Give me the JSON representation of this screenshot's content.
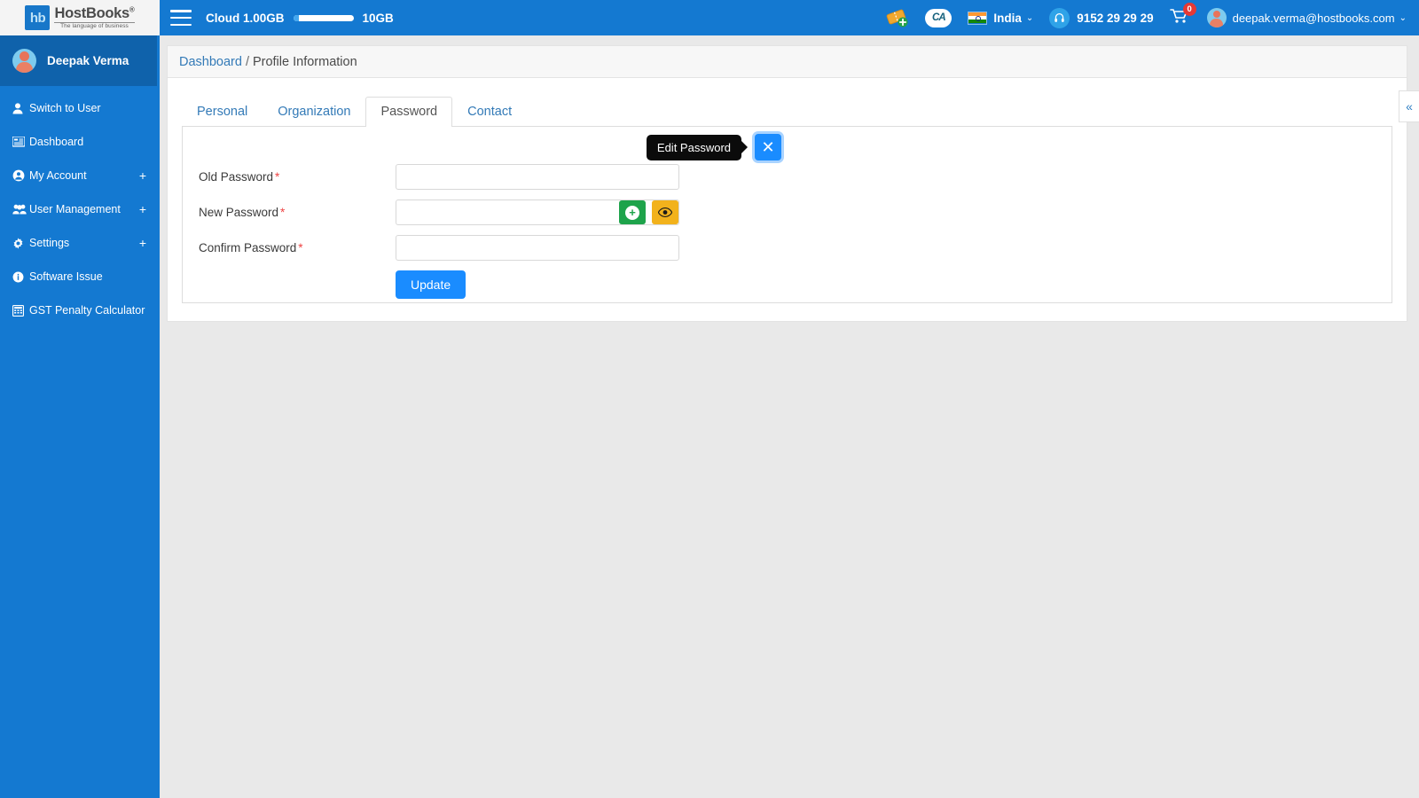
{
  "brand": {
    "tile": "hb",
    "name": "HostBooks",
    "reg": "®",
    "tagline": "The language of business"
  },
  "topbar": {
    "menu_icon": "hamburger-icon",
    "cloud_label": "Cloud 1.00GB",
    "cloud_max": "10GB",
    "cloud_used_percent": 10,
    "ticket_icon": "add-ticket-icon",
    "ca_badge": "CA",
    "country": "India",
    "country_caret": "⌄",
    "support_icon": "headset-icon",
    "phone": "9152 29 29 29",
    "cart_icon": "cart-icon",
    "cart_count": "0",
    "user_email": "deepak.verma@hostbooks.com",
    "user_caret": "⌄"
  },
  "sidebar": {
    "profile_name": "Deepak Verma",
    "items": [
      {
        "label": "Switch to User",
        "icon": "user-icon",
        "glyph": "👤",
        "expand": ""
      },
      {
        "label": "Dashboard",
        "icon": "dashboard-icon",
        "glyph": "☷",
        "expand": ""
      },
      {
        "label": "My Account",
        "icon": "account-circle-icon",
        "glyph": "◉",
        "expand": "+"
      },
      {
        "label": "User Management",
        "icon": "users-group-icon",
        "glyph": "👥",
        "expand": "+"
      },
      {
        "label": "Settings",
        "icon": "gear-icon",
        "glyph": "⚙",
        "expand": "+"
      },
      {
        "label": "Software Issue",
        "icon": "info-circle-icon",
        "glyph": "ℹ",
        "expand": ""
      },
      {
        "label": "GST Penalty Calculator",
        "icon": "calculator-icon",
        "glyph": "▦",
        "expand": ""
      }
    ]
  },
  "breadcrumb": {
    "root": "Dashboard",
    "separator": "/",
    "current": "Profile Information"
  },
  "tabs": [
    {
      "label": "Personal",
      "active": false
    },
    {
      "label": "Organization",
      "active": false
    },
    {
      "label": "Password",
      "active": true
    },
    {
      "label": "Contact",
      "active": false
    }
  ],
  "password_form": {
    "tooltip": "Edit Password",
    "close_icon": "✕",
    "fields": [
      {
        "label": "Old Password",
        "required": "*",
        "value": "",
        "placeholder": ""
      },
      {
        "label": "New Password",
        "required": "*",
        "value": "",
        "placeholder": ""
      },
      {
        "label": "Confirm Password",
        "required": "*",
        "value": "",
        "placeholder": ""
      }
    ],
    "generate_icon": "+",
    "show_password_icon": "👁",
    "submit_label": "Update"
  },
  "collapse_handle": {
    "icon": "«"
  },
  "colors": {
    "brand_blue": "#1479d1",
    "sidebar_dark": "#0f62ab",
    "accent_blue": "#1a8cff",
    "link_blue": "#337ab7",
    "green": "#1ea34b",
    "amber": "#f2b21c",
    "red_badge": "#e53935",
    "page_bg": "#e9e9e9"
  }
}
